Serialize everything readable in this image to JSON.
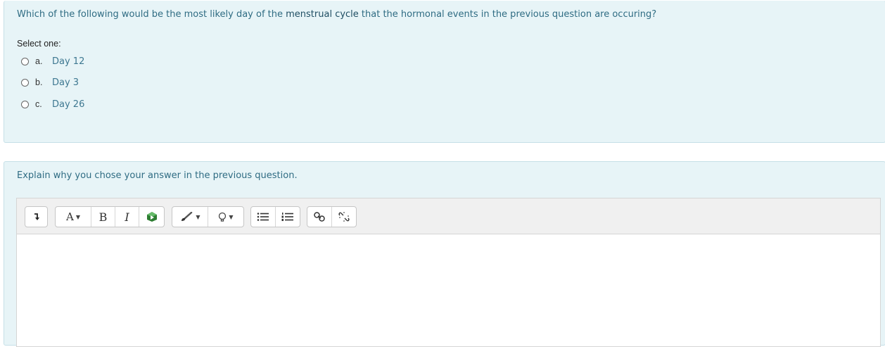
{
  "question1": {
    "text_before": "Which of the following would be the most likely day of the ",
    "text_emphasis": "menstrual cycle",
    "text_after": " that the hormonal events in the previous question are occuring?",
    "prompt": "Select one:",
    "options": [
      {
        "letter": "a.",
        "answer": "Day 12"
      },
      {
        "letter": "b.",
        "answer": "Day 3"
      },
      {
        "letter": "c.",
        "answer": "Day 26"
      }
    ]
  },
  "question2": {
    "text": "Explain why you chose your answer in the previous question.",
    "toolbar": {
      "collapse_icon": "arrow-down-icon",
      "font_style_label": "A",
      "bold_label": "B",
      "italic_label": "I",
      "buttons": [
        "collapse",
        "font-style",
        "bold",
        "italic",
        "media",
        "text-color",
        "background-color",
        "unordered-list",
        "ordered-list",
        "link",
        "unlink"
      ]
    },
    "answer_text": ""
  }
}
